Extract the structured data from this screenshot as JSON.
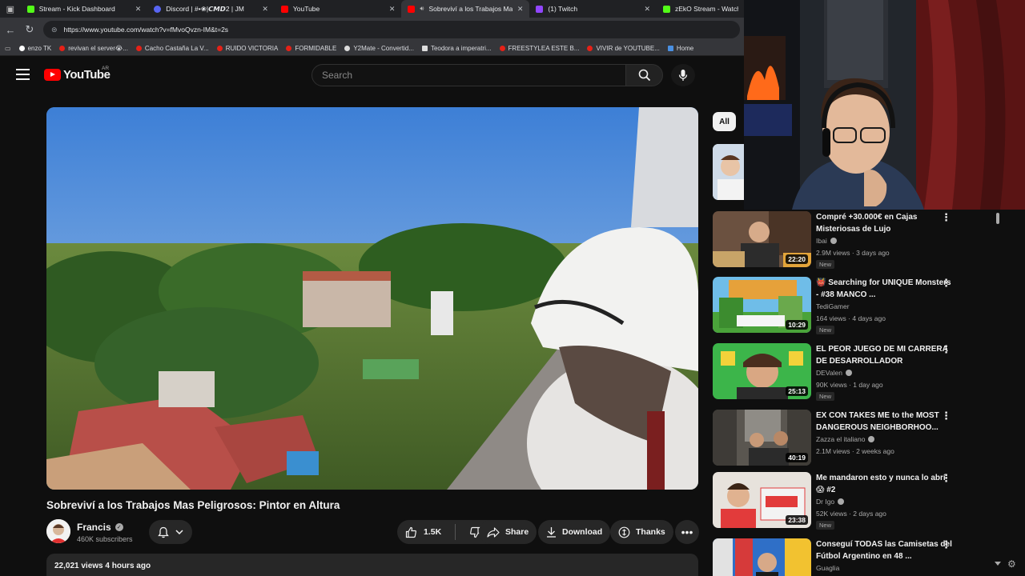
{
  "browser": {
    "tabs": [
      {
        "title": "Stream - Kick Dashboard",
        "favicon_color": "#53fc18",
        "active": false
      },
      {
        "title": "Discord | #•❀|𝘾𝙈𝘿2 | JM",
        "favicon_color": "#5865f2",
        "active": false
      },
      {
        "title": "YouTube",
        "favicon_color": "#ff0000",
        "active": false
      },
      {
        "title": "Sobreviví a los Trabajos Mas",
        "favicon_color": "#ff0000",
        "active": true
      },
      {
        "title": "(1) Twitch",
        "favicon_color": "#9146ff",
        "active": false
      },
      {
        "title": "zEkO Stream - Watch Li",
        "favicon_color": "#53fc18",
        "active": false
      }
    ],
    "url": "https://www.youtube.com/watch?v=fMvoQvzn-IM&t=2s",
    "bookmarks": [
      "enzo TK",
      "revivan el server😭...",
      "Cacho Castaña La V...",
      "RUIDO VICTORIA",
      "FORMIDABLE",
      "Y2Mate - Convertid...",
      "Teodora a imperatri...",
      "FREESTYLEA ESTE B...",
      "VIVIR de YOUTUBE...",
      "Home"
    ]
  },
  "youtube": {
    "logo_text": "YouTube",
    "country_code": "AR",
    "search_placeholder": "Search",
    "brand_color": "#ff0000"
  },
  "video": {
    "title": "Sobreviví a los Trabajos Mas Peligrosos: Pintor en Altura",
    "channel": "Francis",
    "subscribers": "460K subscribers",
    "likes": "1.5K",
    "share_label": "Share",
    "download_label": "Download",
    "thanks_label": "Thanks",
    "views_line": "22,021 views  4 hours ago"
  },
  "sidebar": {
    "chip_all": "All",
    "recommendations": [
      {
        "title": "Compré +30.000€ en Cajas Misteriosas de Lujo",
        "channel": "Ibai",
        "verified": true,
        "meta": "2.9M views · 3 days ago",
        "duration": "22:20",
        "badge": "New"
      },
      {
        "title": "👹 Searching for UNIQUE Monsters - #38 MANCO ...",
        "channel": "TediGamer",
        "verified": false,
        "meta": "164 views · 4 days ago",
        "duration": "10:29",
        "badge": "New"
      },
      {
        "title": "EL PEOR JUEGO DE MI CARRERA DE DESARROLLADOR",
        "channel": "DEValen",
        "verified": true,
        "meta": "90K views · 1 day ago",
        "duration": "25:13",
        "badge": "New"
      },
      {
        "title": "EX CON TAKES ME to the MOST DANGEROUS NEIGHBORHOO...",
        "channel": "Zazza el italiano",
        "verified": true,
        "meta": "2.1M views · 2 weeks ago",
        "duration": "40:19",
        "badge": ""
      },
      {
        "title": "Me mandaron esto y nunca lo abrí 😱 #2",
        "channel": "Dr Igo",
        "verified": true,
        "meta": "52K views · 2 days ago",
        "duration": "23:38",
        "badge": "New"
      },
      {
        "title": "Conseguí TODAS las Camisetas del Fútbol Argentino en 48 ...",
        "channel": "Guaglia",
        "verified": false,
        "meta": "",
        "duration": "",
        "badge": ""
      }
    ]
  }
}
